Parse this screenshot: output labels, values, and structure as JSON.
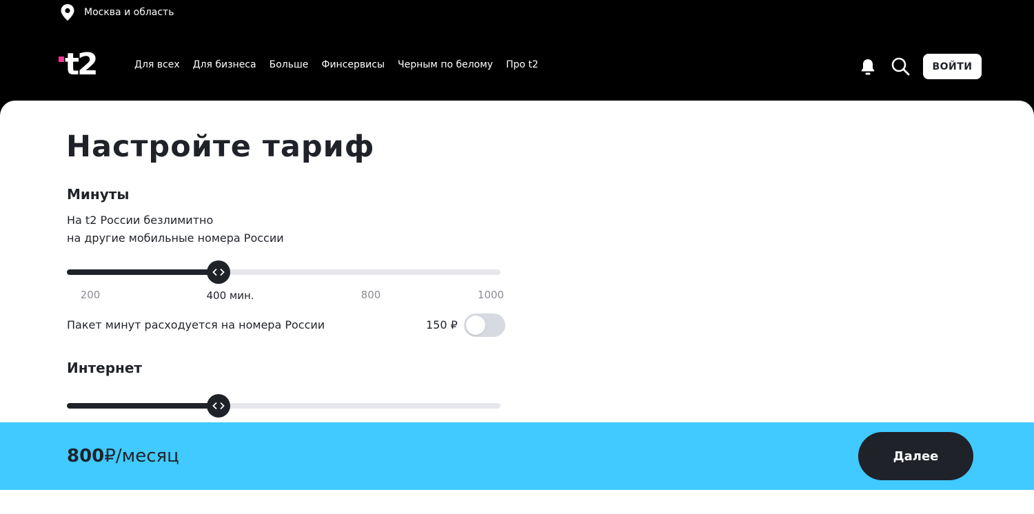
{
  "header": {
    "region": "Москва и область",
    "logo_text": "t2",
    "menu": [
      {
        "label": "Для всех"
      },
      {
        "label": "Для бизнеса"
      },
      {
        "label": "Больше"
      },
      {
        "label": "Финсервисы"
      },
      {
        "label": "Черным по белому"
      },
      {
        "label": "Про t2"
      }
    ],
    "login_label": "ВОЙТИ",
    "icons": [
      "location-pin-icon",
      "bell-icon",
      "search-icon"
    ]
  },
  "main": {
    "title": "Настройте тариф",
    "minutes": {
      "title": "Минуты",
      "description_line1": "На t2 России безлимитно",
      "description_line2": "на другие мобильные номера России",
      "slider": {
        "selected_fraction": 0.35,
        "ticks": [
          {
            "label": "200",
            "active": false
          },
          {
            "label": "400 мин.",
            "active": true
          },
          {
            "label": "800",
            "active": false
          },
          {
            "label": "1000",
            "active": false
          }
        ]
      },
      "package": {
        "label": "Пакет минут расходуется на номера России",
        "price": "150 ₽",
        "enabled": false
      }
    },
    "internet": {
      "title": "Интернет",
      "slider": {
        "selected_fraction": 0.35
      }
    }
  },
  "footer": {
    "price_value": "800",
    "price_unit": "₽/месяц",
    "next_label": "Далее"
  },
  "colors": {
    "background_top": "#000000",
    "accent_pink": "#ff3495",
    "footer_bg": "#40caff",
    "dark": "#1f2229",
    "track": "#e6e7ec"
  }
}
